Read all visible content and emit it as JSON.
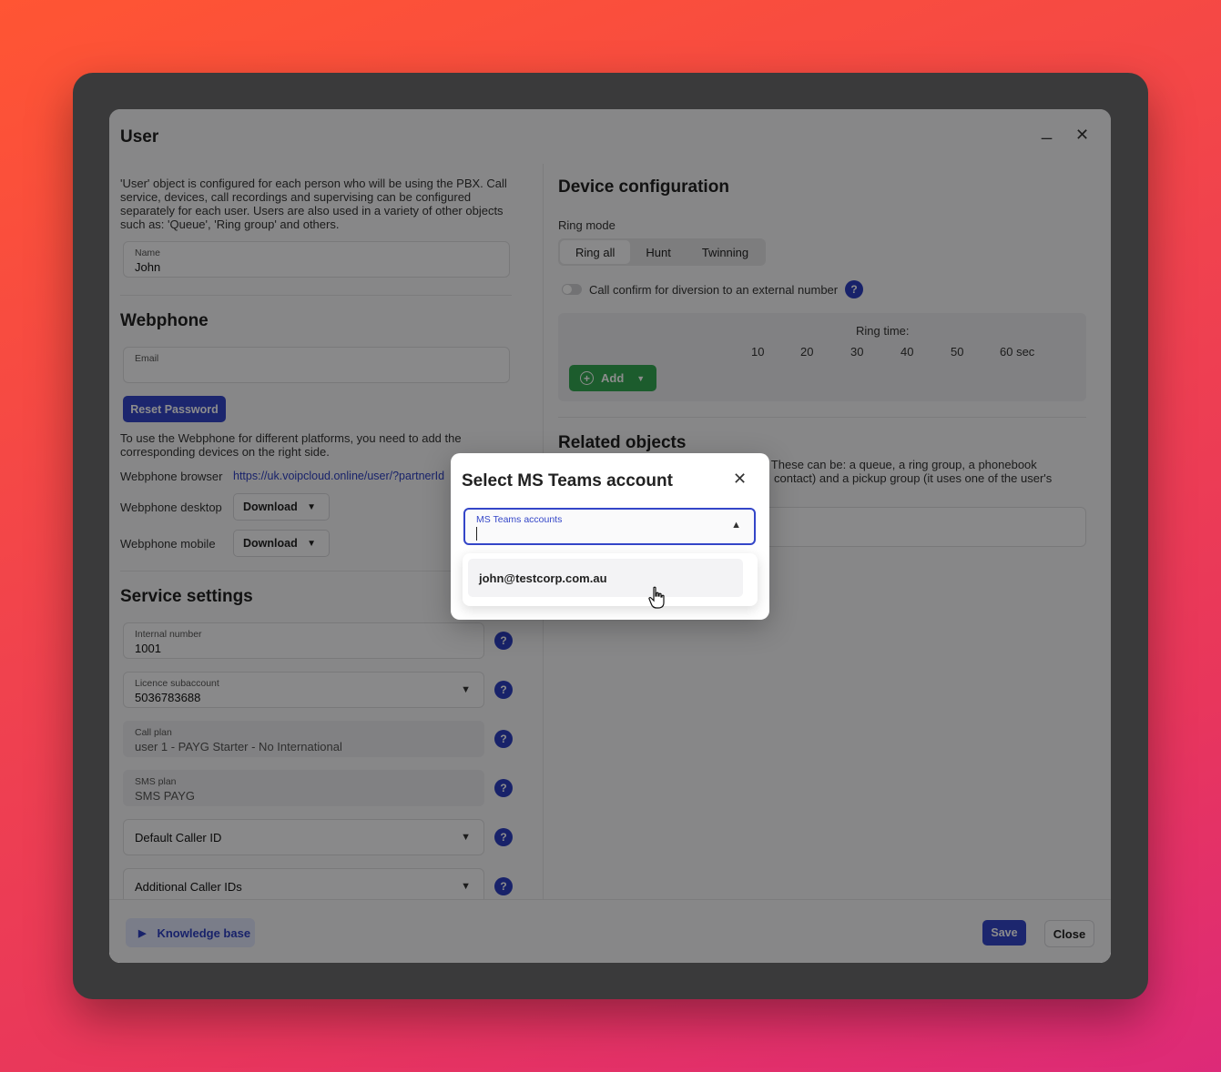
{
  "window": {
    "title": "User",
    "minimize_glyph": "_",
    "close_glyph": "✕"
  },
  "intro": "'User' object is configured for each person who will be using the PBX. Call service, devices, call recordings and supervising can be configured separately for each user. Users are also used in a variety of other objects such as: 'Queue', 'Ring group' and others.",
  "name_field": {
    "label": "Name",
    "value": "John"
  },
  "webphone": {
    "title": "Webphone",
    "email_label": "Email",
    "email_value": "",
    "reset_password": "Reset Password",
    "note": "To use the Webphone for different platforms, you need to add the corresponding devices on the right side.",
    "browser_label": "Webphone browser",
    "browser_link": "https://uk.voipcloud.online/user/?partnerId",
    "desktop_label": "Webphone desktop",
    "desktop_button": "Download",
    "mobile_label": "Webphone mobile",
    "mobile_button": "Download"
  },
  "service": {
    "title": "Service settings",
    "internal_number": {
      "label": "Internal number",
      "value": "1001"
    },
    "licence": {
      "label": "Licence subaccount",
      "value": "5036783688"
    },
    "call_plan": {
      "label": "Call plan",
      "value": "user 1 - PAYG Starter - No International"
    },
    "sms_plan": {
      "label": "SMS plan",
      "value": "SMS PAYG"
    },
    "default_caller_id": "Default Caller ID",
    "additional_caller_ids": "Additional Caller IDs",
    "help_glyph": "?"
  },
  "device": {
    "title": "Device configuration",
    "ring_mode_label": "Ring mode",
    "ring_modes": [
      "Ring all",
      "Hunt",
      "Twinning"
    ],
    "active_ring_mode": "Ring all",
    "call_confirm_label": "Call confirm for diversion to an external number",
    "ring_time_label": "Ring time:",
    "ring_ticks": [
      "10",
      "20",
      "30",
      "40",
      "50",
      "60 sec"
    ],
    "add_button": "Add"
  },
  "related": {
    "title": "Related objects",
    "text_line1": "pates. These can be: a queue, a ring group, a phonebook",
    "text_line2": "contact) and a pickup group (it uses one of the user's"
  },
  "footer": {
    "knowledge_base": "Knowledge base",
    "save": "Save",
    "close": "Close"
  },
  "modal": {
    "title": "Select MS Teams account",
    "close_glyph": "✕",
    "field_label": "MS Teams accounts",
    "field_value": "",
    "options": [
      "john@testcorp.com.au"
    ]
  },
  "colors": {
    "accent": "#3446c8",
    "add_green": "#34a852",
    "link": "#2d3fc2"
  }
}
